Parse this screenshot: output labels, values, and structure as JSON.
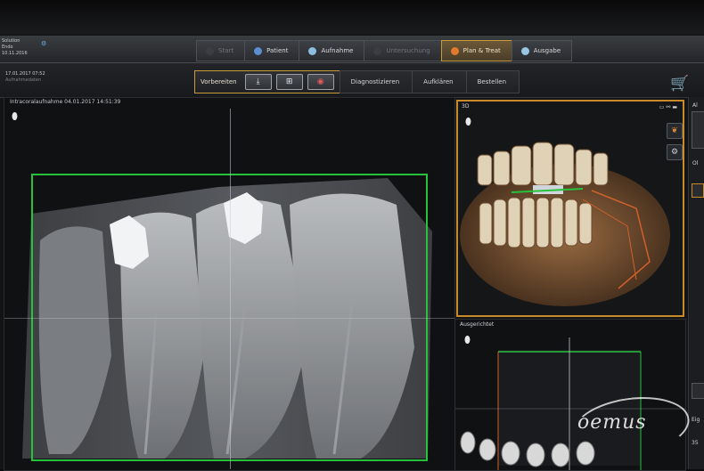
{
  "patient": {
    "line1": "Solution",
    "line2": "Endo",
    "line3": "10.11.2016"
  },
  "workflow": {
    "steps": [
      {
        "label": "Start",
        "state": "dim"
      },
      {
        "label": "Patient",
        "state": "normal"
      },
      {
        "label": "Aufnahme",
        "state": "normal"
      },
      {
        "label": "Untersuchung",
        "state": "dim"
      },
      {
        "label": "Plan & Treat",
        "state": "active"
      },
      {
        "label": "Ausgabe",
        "state": "normal"
      }
    ]
  },
  "session": {
    "date": "17.01.2017 07:52",
    "subtitle": "Aufnahmedaten"
  },
  "substeps": {
    "current_label": "Vorbereiten",
    "steps": [
      "Diagnostizieren",
      "Aufklären",
      "Bestellen"
    ]
  },
  "xray_panel": {
    "title": "Intracoralaufnahme 04.01.2017 14:51:39"
  },
  "panel_3d": {
    "title": "3D"
  },
  "panel_aligned": {
    "title": "Ausgerichtet"
  },
  "sidebar": {
    "label_top": "Al",
    "label_mid": "Ol",
    "label_bottom": "Eig",
    "value_bottom": "35"
  },
  "watermark": "oemus",
  "colors": {
    "accent_orange": "#c98a2a",
    "roi_green": "#27c23b",
    "active_step": "#6b5838"
  },
  "icons": {
    "cart": "cart-icon",
    "tooth": "tooth-icon",
    "settings": "gear-icon"
  }
}
